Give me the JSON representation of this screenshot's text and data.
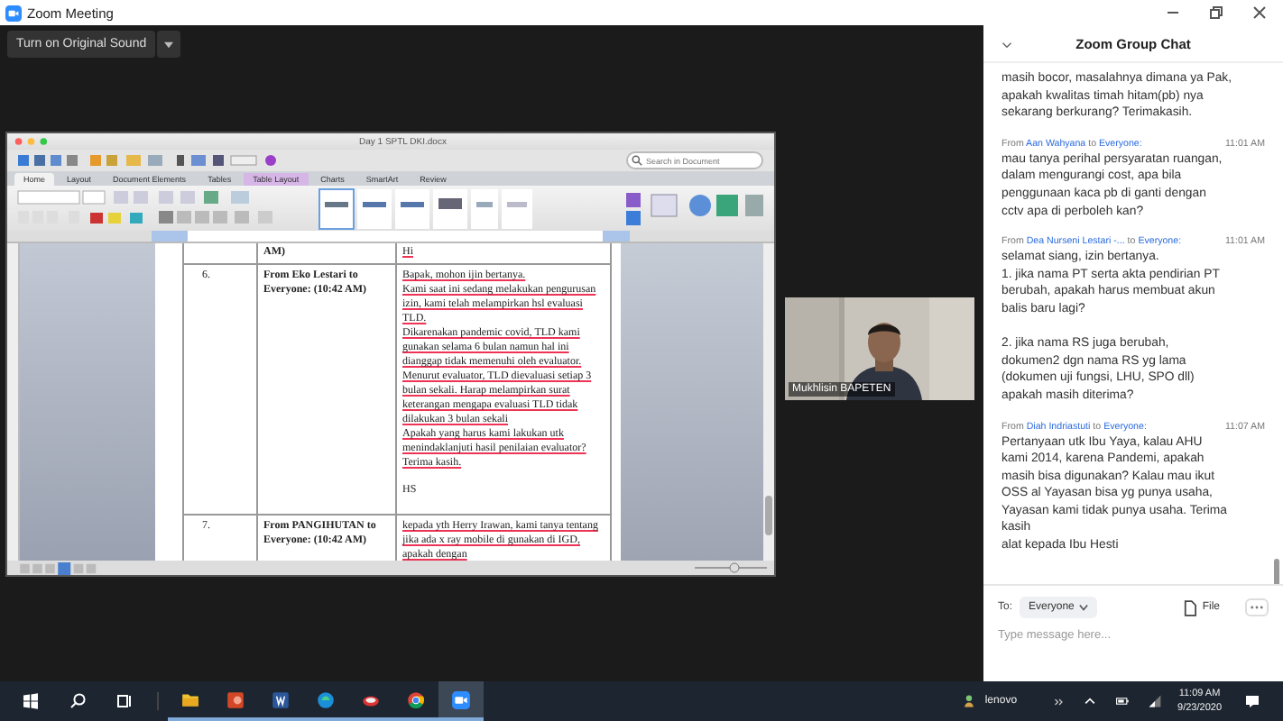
{
  "window": {
    "title": "Zoom Meeting"
  },
  "original_sound_button": {
    "label": "Turn on Original Sound"
  },
  "shared_document": {
    "title": "Day 1 SPTL DKI.docx",
    "search_placeholder": "Search in Document",
    "ribbon_tabs": [
      {
        "label": "Home",
        "selected": true,
        "contextual": false
      },
      {
        "label": "Layout",
        "selected": false,
        "contextual": false
      },
      {
        "label": "Document Elements",
        "selected": false,
        "contextual": false
      },
      {
        "label": "Tables",
        "selected": false,
        "contextual": false
      },
      {
        "label": "Table Layout",
        "selected": false,
        "contextual": true
      },
      {
        "label": "Charts",
        "selected": false,
        "contextual": false
      },
      {
        "label": "SmartArt",
        "selected": false,
        "contextual": false
      },
      {
        "label": "Review",
        "selected": false,
        "contextual": false
      }
    ],
    "table_rows": [
      {
        "number": "",
        "sender": "AM)",
        "message": [
          "Hi"
        ]
      },
      {
        "number": "6.",
        "sender": "From Eko Lestari to Everyone: (10:42 AM)",
        "message": [
          "Bapak, mohon ijin bertanya.",
          "Kami saat ini sedang melakukan pengurusan izin, kami telah melampirkan hsl evaluasi TLD.",
          "Dikarenakan pandemic covid, TLD kami gunakan selama 6 bulan namun hal ini dianggap tidak memenuhi oleh evaluator.",
          "Menurut evaluator, TLD dievaluasi setiap 3 bulan sekali. Harap melampirkan surat keterangan mengapa evaluasi TLD tidak dilakukan 3 bulan sekali",
          "Apakah yang harus kami lakukan utk menindaklanjuti hasil penilaian evaluator?",
          "Terima kasih.",
          "HS"
        ]
      },
      {
        "number": "7.",
        "sender": "From PANGIHUTAN to Everyone: (10:42 AM)",
        "message": [
          "kepada yth Herry Irawan, kami tanya tentang jika ada x ray mobile di gunakan di IGD, apakah dengan"
        ]
      }
    ]
  },
  "video_tile": {
    "name": "Mukhlisin BAPETEN"
  },
  "chat": {
    "title": "Zoom Group Chat",
    "messages": [
      {
        "text": "masih bocor, masalahnya dimana ya Pak,\napakah kwalitas  timah hitam(pb) nya\nsekarang berkurang? Terimakasih."
      },
      {
        "from_word": "From",
        "from": "Aan Wahyana",
        "to_word": "to",
        "to": "Everyone:",
        "time": "11:01 AM",
        "text": "mau tanya perihal persyaratan ruangan,\ndalam mengurangi cost, apa bila\npenggunaan kaca pb di ganti dengan\ncctv apa di perboleh kan?"
      },
      {
        "from_word": "From",
        "from": "Dea Nurseni Lestari -...",
        "to_word": "to",
        "to": "Everyone:",
        "time": "11:01 AM",
        "text": "selamat siang, izin bertanya.\n1. jika nama PT serta akta pendirian  PT\nberubah, apakah harus membuat akun\nbalis baru lagi?\n\n2. jika nama RS juga berubah,\ndokumen2 dgn nama RS yg lama\n(dokumen uji fungsi, LHU, SPO dll)\napakah masih diterima?"
      },
      {
        "from_word": "From",
        "from": "Diah Indriastuti",
        "to_word": "to",
        "to": "Everyone:",
        "time": "11:07 AM",
        "text": "Pertanyaan utk Ibu Yaya, kalau AHU\nkami 2014, karena Pandemi, apakah\nmasih bisa digunakan? Kalau mau ikut\nOSS al Yayasan bisa yg punya usaha,\nYayasan kami tidak punya usaha.  Terima\nkasih\nalat kepada Ibu Hesti"
      }
    ],
    "to_label": "To:",
    "recipient": "Everyone",
    "file_label": "File",
    "placeholder": "Type message here..."
  },
  "taskbar": {
    "apps": [
      {
        "kind": "explorer",
        "selected": false
      },
      {
        "kind": "powerpoint",
        "selected": false
      },
      {
        "kind": "word",
        "selected": false
      },
      {
        "kind": "edge",
        "selected": false
      },
      {
        "kind": "app",
        "selected": false
      },
      {
        "kind": "chrome",
        "selected": false
      },
      {
        "kind": "zoom",
        "selected": true
      }
    ],
    "user": "lenovo",
    "time": "11:09 AM",
    "date": "9/23/2020"
  }
}
